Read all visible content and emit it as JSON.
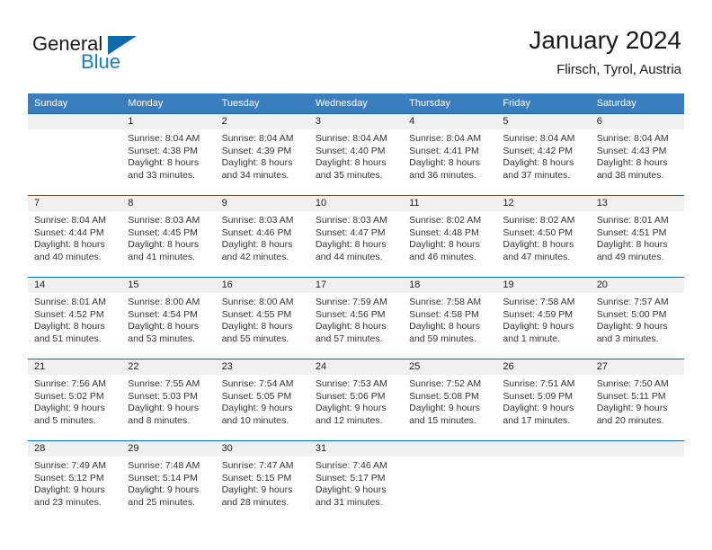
{
  "brand": {
    "name_part1": "General",
    "name_part2": "Blue",
    "triangle_color": "#1068ad",
    "blue_color": "#1f7ac0"
  },
  "header": {
    "title": "January 2024",
    "location": "Flirsch, Tyrol, Austria"
  },
  "theme": {
    "header_blue": "#3a7ebf",
    "divider_blue": "#19629e",
    "daynum_band": "#f0f0f0"
  },
  "weekdays": [
    "Sunday",
    "Monday",
    "Tuesday",
    "Wednesday",
    "Thursday",
    "Friday",
    "Saturday"
  ],
  "weeks": [
    {
      "days": [
        {
          "num": "",
          "l1": "",
          "l2": "",
          "l3": "",
          "l4": ""
        },
        {
          "num": "1",
          "l1": "Sunrise: 8:04 AM",
          "l2": "Sunset: 4:38 PM",
          "l3": "Daylight: 8 hours",
          "l4": "and 33 minutes."
        },
        {
          "num": "2",
          "l1": "Sunrise: 8:04 AM",
          "l2": "Sunset: 4:39 PM",
          "l3": "Daylight: 8 hours",
          "l4": "and 34 minutes."
        },
        {
          "num": "3",
          "l1": "Sunrise: 8:04 AM",
          "l2": "Sunset: 4:40 PM",
          "l3": "Daylight: 8 hours",
          "l4": "and 35 minutes."
        },
        {
          "num": "4",
          "l1": "Sunrise: 8:04 AM",
          "l2": "Sunset: 4:41 PM",
          "l3": "Daylight: 8 hours",
          "l4": "and 36 minutes."
        },
        {
          "num": "5",
          "l1": "Sunrise: 8:04 AM",
          "l2": "Sunset: 4:42 PM",
          "l3": "Daylight: 8 hours",
          "l4": "and 37 minutes."
        },
        {
          "num": "6",
          "l1": "Sunrise: 8:04 AM",
          "l2": "Sunset: 4:43 PM",
          "l3": "Daylight: 8 hours",
          "l4": "and 38 minutes."
        }
      ]
    },
    {
      "days": [
        {
          "num": "7",
          "l1": "Sunrise: 8:04 AM",
          "l2": "Sunset: 4:44 PM",
          "l3": "Daylight: 8 hours",
          "l4": "and 40 minutes."
        },
        {
          "num": "8",
          "l1": "Sunrise: 8:03 AM",
          "l2": "Sunset: 4:45 PM",
          "l3": "Daylight: 8 hours",
          "l4": "and 41 minutes."
        },
        {
          "num": "9",
          "l1": "Sunrise: 8:03 AM",
          "l2": "Sunset: 4:46 PM",
          "l3": "Daylight: 8 hours",
          "l4": "and 42 minutes."
        },
        {
          "num": "10",
          "l1": "Sunrise: 8:03 AM",
          "l2": "Sunset: 4:47 PM",
          "l3": "Daylight: 8 hours",
          "l4": "and 44 minutes."
        },
        {
          "num": "11",
          "l1": "Sunrise: 8:02 AM",
          "l2": "Sunset: 4:48 PM",
          "l3": "Daylight: 8 hours",
          "l4": "and 46 minutes."
        },
        {
          "num": "12",
          "l1": "Sunrise: 8:02 AM",
          "l2": "Sunset: 4:50 PM",
          "l3": "Daylight: 8 hours",
          "l4": "and 47 minutes."
        },
        {
          "num": "13",
          "l1": "Sunrise: 8:01 AM",
          "l2": "Sunset: 4:51 PM",
          "l3": "Daylight: 8 hours",
          "l4": "and 49 minutes."
        }
      ]
    },
    {
      "days": [
        {
          "num": "14",
          "l1": "Sunrise: 8:01 AM",
          "l2": "Sunset: 4:52 PM",
          "l3": "Daylight: 8 hours",
          "l4": "and 51 minutes."
        },
        {
          "num": "15",
          "l1": "Sunrise: 8:00 AM",
          "l2": "Sunset: 4:54 PM",
          "l3": "Daylight: 8 hours",
          "l4": "and 53 minutes."
        },
        {
          "num": "16",
          "l1": "Sunrise: 8:00 AM",
          "l2": "Sunset: 4:55 PM",
          "l3": "Daylight: 8 hours",
          "l4": "and 55 minutes."
        },
        {
          "num": "17",
          "l1": "Sunrise: 7:59 AM",
          "l2": "Sunset: 4:56 PM",
          "l3": "Daylight: 8 hours",
          "l4": "and 57 minutes."
        },
        {
          "num": "18",
          "l1": "Sunrise: 7:58 AM",
          "l2": "Sunset: 4:58 PM",
          "l3": "Daylight: 8 hours",
          "l4": "and 59 minutes."
        },
        {
          "num": "19",
          "l1": "Sunrise: 7:58 AM",
          "l2": "Sunset: 4:59 PM",
          "l3": "Daylight: 9 hours",
          "l4": "and 1 minute."
        },
        {
          "num": "20",
          "l1": "Sunrise: 7:57 AM",
          "l2": "Sunset: 5:00 PM",
          "l3": "Daylight: 9 hours",
          "l4": "and 3 minutes."
        }
      ]
    },
    {
      "days": [
        {
          "num": "21",
          "l1": "Sunrise: 7:56 AM",
          "l2": "Sunset: 5:02 PM",
          "l3": "Daylight: 9 hours",
          "l4": "and 5 minutes."
        },
        {
          "num": "22",
          "l1": "Sunrise: 7:55 AM",
          "l2": "Sunset: 5:03 PM",
          "l3": "Daylight: 9 hours",
          "l4": "and 8 minutes."
        },
        {
          "num": "23",
          "l1": "Sunrise: 7:54 AM",
          "l2": "Sunset: 5:05 PM",
          "l3": "Daylight: 9 hours",
          "l4": "and 10 minutes."
        },
        {
          "num": "24",
          "l1": "Sunrise: 7:53 AM",
          "l2": "Sunset: 5:06 PM",
          "l3": "Daylight: 9 hours",
          "l4": "and 12 minutes."
        },
        {
          "num": "25",
          "l1": "Sunrise: 7:52 AM",
          "l2": "Sunset: 5:08 PM",
          "l3": "Daylight: 9 hours",
          "l4": "and 15 minutes."
        },
        {
          "num": "26",
          "l1": "Sunrise: 7:51 AM",
          "l2": "Sunset: 5:09 PM",
          "l3": "Daylight: 9 hours",
          "l4": "and 17 minutes."
        },
        {
          "num": "27",
          "l1": "Sunrise: 7:50 AM",
          "l2": "Sunset: 5:11 PM",
          "l3": "Daylight: 9 hours",
          "l4": "and 20 minutes."
        }
      ]
    },
    {
      "days": [
        {
          "num": "28",
          "l1": "Sunrise: 7:49 AM",
          "l2": "Sunset: 5:12 PM",
          "l3": "Daylight: 9 hours",
          "l4": "and 23 minutes."
        },
        {
          "num": "29",
          "l1": "Sunrise: 7:48 AM",
          "l2": "Sunset: 5:14 PM",
          "l3": "Daylight: 9 hours",
          "l4": "and 25 minutes."
        },
        {
          "num": "30",
          "l1": "Sunrise: 7:47 AM",
          "l2": "Sunset: 5:15 PM",
          "l3": "Daylight: 9 hours",
          "l4": "and 28 minutes."
        },
        {
          "num": "31",
          "l1": "Sunrise: 7:46 AM",
          "l2": "Sunset: 5:17 PM",
          "l3": "Daylight: 9 hours",
          "l4": "and 31 minutes."
        },
        {
          "num": "",
          "l1": "",
          "l2": "",
          "l3": "",
          "l4": ""
        },
        {
          "num": "",
          "l1": "",
          "l2": "",
          "l3": "",
          "l4": ""
        },
        {
          "num": "",
          "l1": "",
          "l2": "",
          "l3": "",
          "l4": ""
        }
      ]
    }
  ]
}
